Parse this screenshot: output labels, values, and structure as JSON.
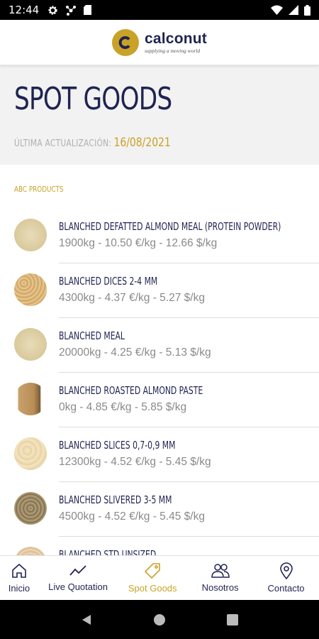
{
  "status_bar": {
    "time": "12:44"
  },
  "brand": {
    "name": "calconut",
    "tagline": "supplying a moving world",
    "accent": "#c9a227",
    "navy": "#1f2352"
  },
  "page": {
    "title": "SPOT GOODS",
    "update_label": "ÚLTIMA ACTUALIZACIÓN:",
    "update_date": "16/08/2021"
  },
  "section": {
    "label": "ABC PRODUCTS"
  },
  "products": [
    {
      "name": "BLANCHED DEFATTED ALMOND MEAL (PROTEIN POWDER)",
      "detail": "1900kg - 10.50 €/kg - 12.66 $/kg",
      "thumb": "meal"
    },
    {
      "name": "BLANCHED DICES 2-4 MM",
      "detail": "4300kg - 4.37 €/kg - 5.27 $/kg",
      "thumb": "dices"
    },
    {
      "name": "BLANCHED MEAL",
      "detail": "20000kg - 4.25 €/kg - 5.13 $/kg",
      "thumb": "meal"
    },
    {
      "name": "BLANCHED ROASTED ALMOND PASTE",
      "detail": "0kg - 4.85 €/kg - 5.85 $/kg",
      "thumb": "paste"
    },
    {
      "name": "BLANCHED SLICES 0,7-0,9 MM",
      "detail": "12300kg - 4.52 €/kg - 5.45 $/kg",
      "thumb": "slices"
    },
    {
      "name": "BLANCHED SLIVERED 3-5 MM",
      "detail": "4500kg - 4.52 €/kg - 5.45 $/kg",
      "thumb": "slivered"
    },
    {
      "name": "BLANCHED STD UNSIZED",
      "detail": "",
      "thumb": "unsized"
    }
  ],
  "bottom_nav": [
    {
      "label": "Inicio",
      "icon": "home-icon"
    },
    {
      "label": "Live Quotation",
      "icon": "trend-icon"
    },
    {
      "label": "Spot Goods",
      "icon": "tag-icon",
      "active": true
    },
    {
      "label": "Nosotros",
      "icon": "people-icon"
    },
    {
      "label": "Contacto",
      "icon": "location-pin-icon"
    }
  ]
}
